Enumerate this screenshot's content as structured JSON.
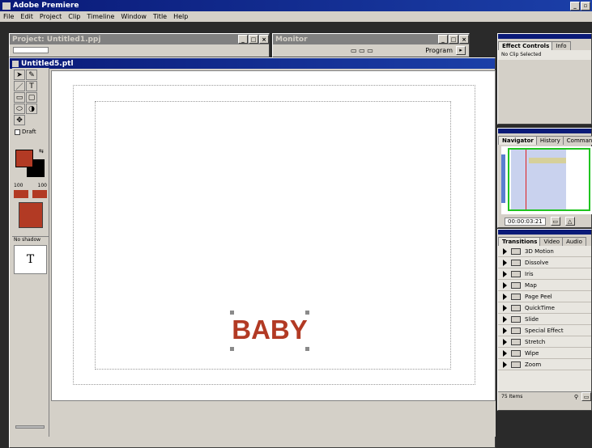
{
  "app": {
    "title": "Adobe Premiere"
  },
  "menu": [
    "File",
    "Edit",
    "Project",
    "Clip",
    "Timeline",
    "Window",
    "Title",
    "Help"
  ],
  "project_window": {
    "title": "Project: Untitled1.ppj"
  },
  "monitor_window": {
    "title": "Monitor",
    "program_label": "Program"
  },
  "title_window": {
    "title": "Untitled5.ptl",
    "text": "BABY",
    "text_color": "#b23a24"
  },
  "tools": {
    "draft_label": "Draft",
    "opacity_left": "100",
    "opacity_right": "100",
    "shadow_label": "No shadow",
    "type_sample": "T"
  },
  "effect_controls": {
    "tabs": [
      "Effect Controls",
      "Info"
    ],
    "status": "No Clip Selected"
  },
  "navigator": {
    "tabs": [
      "Navigator",
      "History",
      "Commands"
    ],
    "timecode": "00:00:03:21"
  },
  "transitions": {
    "tabs": [
      "Transitions",
      "Video",
      "Audio"
    ],
    "items": [
      "3D Motion",
      "Dissolve",
      "Iris",
      "Map",
      "Page Peel",
      "QuickTime",
      "Slide",
      "Special Effect",
      "Stretch",
      "Wipe",
      "Zoom"
    ],
    "footer": "75 Items"
  }
}
